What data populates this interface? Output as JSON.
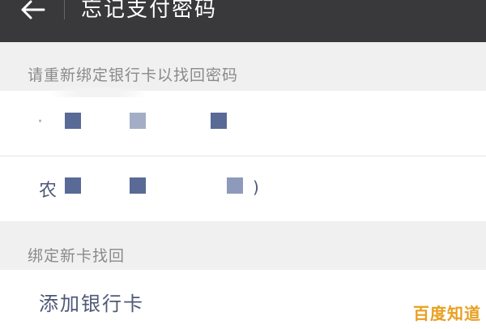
{
  "header": {
    "title": "忘记支付密码",
    "background": "#39393b"
  },
  "section_rebind": {
    "label": "请重新绑定银行卡以找回密码"
  },
  "bank_cards": [
    {
      "prefix": "·",
      "mask_colors": [
        "#5a6a96",
        "#a3aec6",
        "#5a6a96"
      ]
    },
    {
      "prefix": "农",
      "suffix": ")",
      "mask_colors": [
        "#5a6a96",
        "#5a6a96",
        "#8d9abb"
      ]
    }
  ],
  "section_newcard": {
    "label": "绑定新卡找回"
  },
  "add_card": {
    "label": "添加银行卡"
  },
  "watermark": {
    "text": "百度知道",
    "color": "#e8a020"
  },
  "colors": {
    "accent_text": "#4f5878",
    "section_text": "#8a8a8a",
    "page_bg": "#f0f0f0"
  }
}
